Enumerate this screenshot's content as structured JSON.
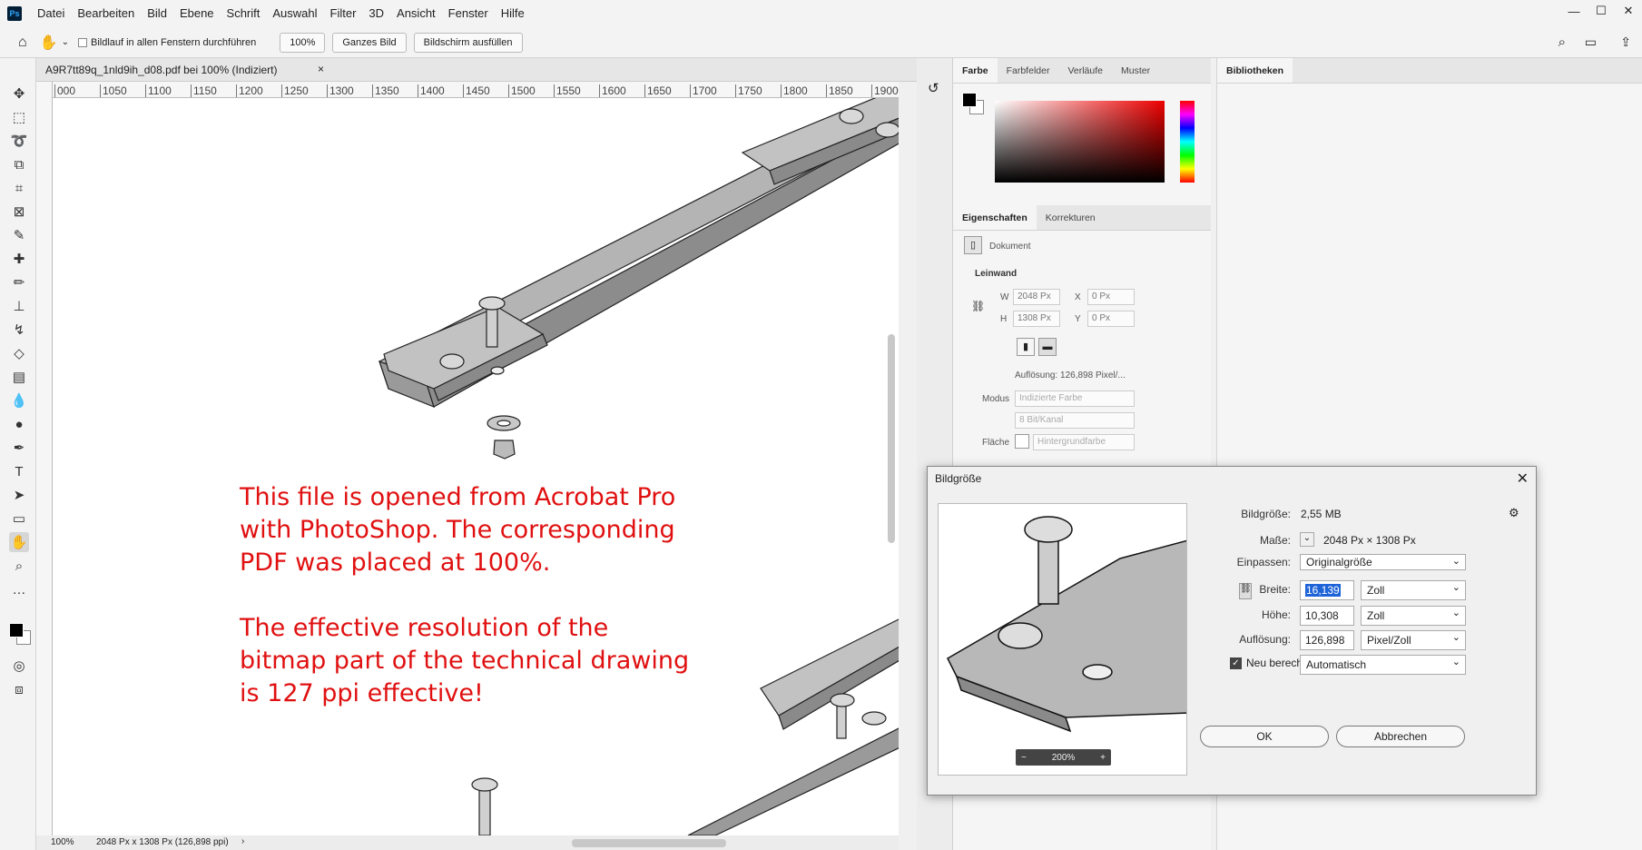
{
  "menubar": {
    "logo": "Ps",
    "items": [
      "Datei",
      "Bearbeiten",
      "Bild",
      "Ebene",
      "Schrift",
      "Auswahl",
      "Filter",
      "3D",
      "Ansicht",
      "Fenster",
      "Hilfe"
    ]
  },
  "optionsbar": {
    "scroll_all_label": "Bildlauf in allen Fenstern durchführen",
    "zoom_btn": "100%",
    "fit_btn": "Ganzes Bild",
    "fill_btn": "Bildschirm ausfüllen"
  },
  "document": {
    "tab_title": "A9R7tt89q_1nld9ih_d08.pdf bei 100% (Indiziert)",
    "ruler_ticks": [
      "000",
      "1050",
      "1100",
      "1150",
      "1200",
      "1250",
      "1300",
      "1350",
      "1400",
      "1450",
      "1500",
      "1550",
      "1600",
      "1650",
      "1700",
      "1750",
      "1800",
      "1850",
      "1900"
    ],
    "zoom": "100%",
    "status": "2048 Px x 1308 Px (126,898 ppi)"
  },
  "annotation": {
    "lines1": [
      "This file is opened from Acrobat Pro",
      "with PhotoShop. The corresponding",
      "PDF was placed at 100%."
    ],
    "lines2": [
      "The effective resolution of the",
      "bitmap part of the technical drawing",
      "is 127 ppi effective!"
    ]
  },
  "colorpanel": {
    "tabs": [
      "Farbe",
      "Farbfelder",
      "Verläufe",
      "Muster"
    ]
  },
  "props": {
    "tabs": [
      "Eigenschaften",
      "Korrekturen"
    ],
    "doc_label": "Dokument",
    "section": "Leinwand",
    "w_label": "W",
    "w_value": "2048 Px",
    "x_label": "X",
    "x_value": "0 Px",
    "h_label": "H",
    "h_value": "1308 Px",
    "y_label": "Y",
    "y_value": "0 Px",
    "resolution": "Auflösung:  126,898  Pixel/...",
    "mode_label": "Modus",
    "mode_value": "Indizierte Farbe",
    "depth_value": "8 Bit/Kanal",
    "fill_label": "Fläche",
    "fill_value": "Hintergrundfarbe"
  },
  "libraries": {
    "tab": "Bibliotheken"
  },
  "dialog": {
    "title": "Bildgröße",
    "size_label": "Bildgröße:",
    "size_value": "2,55 MB",
    "dims_label": "Maße:",
    "dims_value": "2048 Px  ×  1308 Px",
    "fit_label": "Einpassen:",
    "fit_value": "Originalgröße",
    "width_label": "Breite:",
    "width_value": "16,139",
    "width_unit": "Zoll",
    "height_label": "Höhe:",
    "height_value": "10,308",
    "height_unit": "Zoll",
    "res_label": "Auflösung:",
    "res_value": "126,898",
    "res_unit": "Pixel/Zoll",
    "resample_label": "Neu berechnen:",
    "resample_value": "Automatisch",
    "ok": "OK",
    "cancel": "Abbrechen",
    "preview_zoom": "200%"
  }
}
